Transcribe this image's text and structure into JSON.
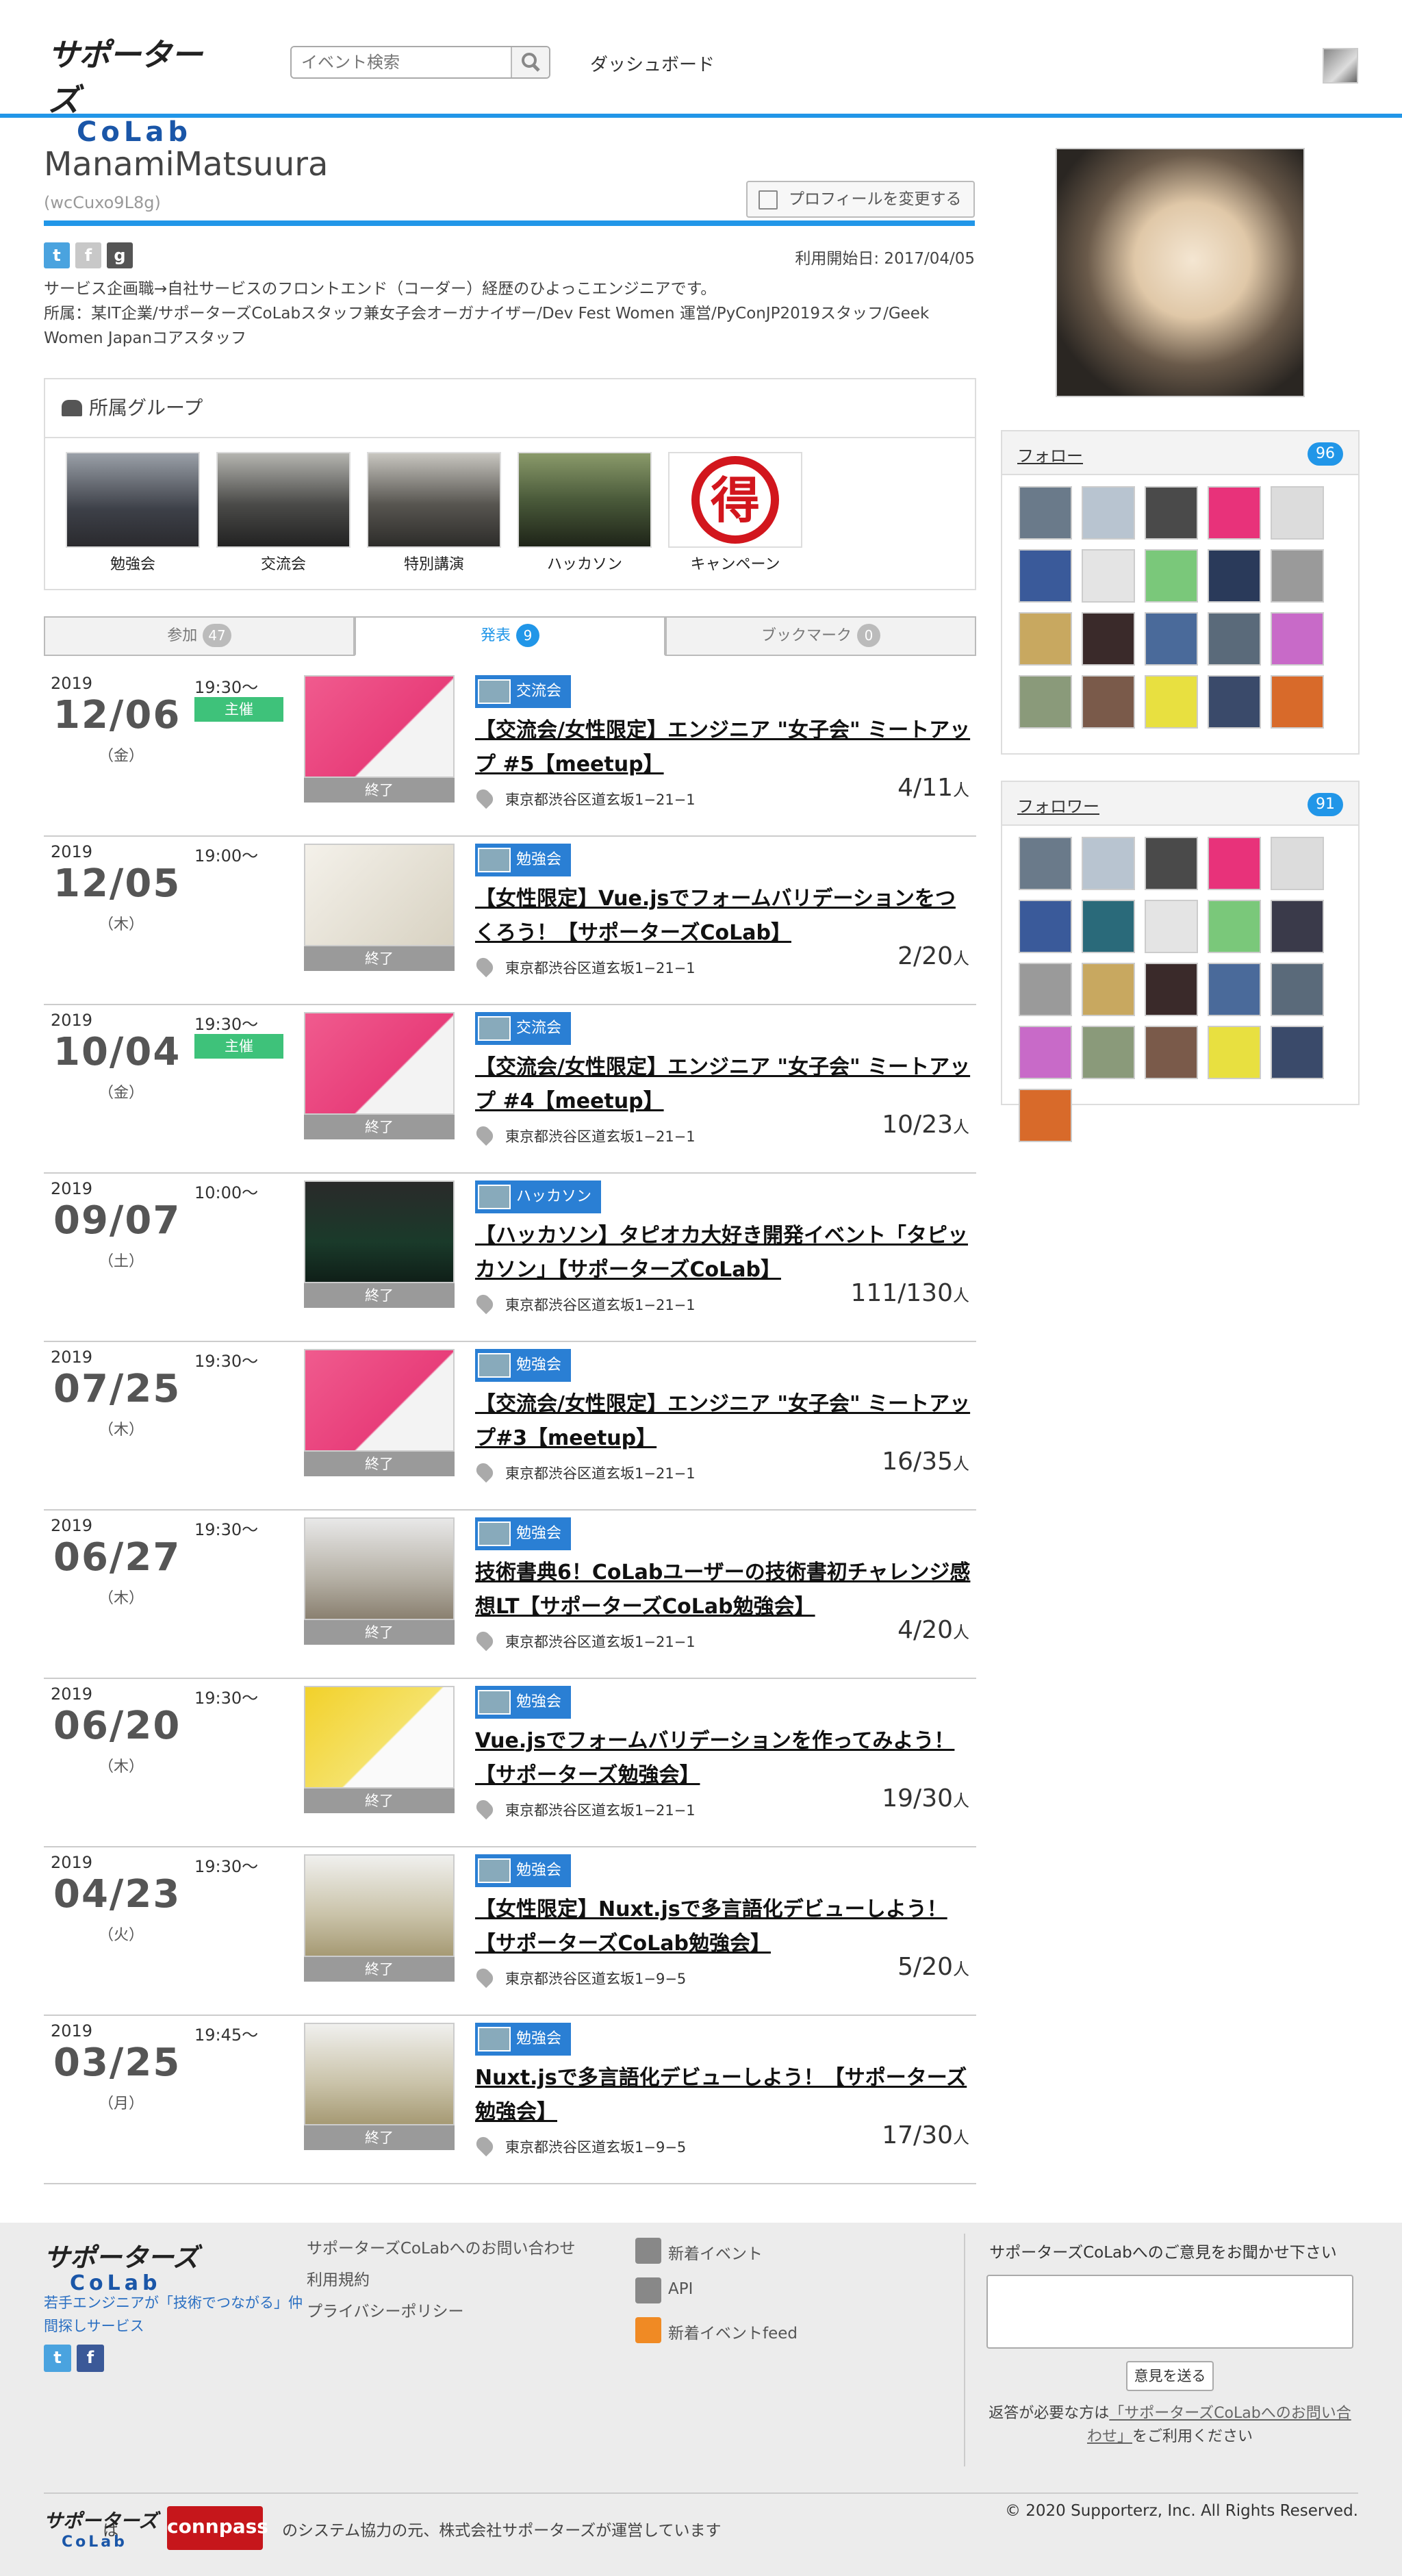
{
  "header": {
    "logo_line1": "サポーターズ",
    "logo_line2": "CoLab",
    "search_placeholder": "イベント検索",
    "dashboard": "ダッシュボード"
  },
  "profile": {
    "name": "ManamiMatsuura",
    "id": "(wcCuxo9L8g)",
    "edit_button": "プロフィールを変更する",
    "since": "利用開始日: 2017/04/05",
    "bio_line1": "サービス企画職→自社サービスのフロントエンド（コーダー）経歴のひよっこエンジニアです。",
    "bio_line2": "所属：某IT企業/サポーターズCoLabスタッフ兼女子会オーガナイザー/Dev Fest Women 運営/PyConJP2019スタッフ/Geek Women Japanコアスタッフ",
    "social": [
      "twitter-icon",
      "facebook-icon",
      "github-icon"
    ]
  },
  "groups": {
    "title": "所属グループ",
    "items": [
      {
        "label": "勉強会"
      },
      {
        "label": "交流会"
      },
      {
        "label": "特別講演"
      },
      {
        "label": "ハッカソン"
      },
      {
        "label": "キャンペーン"
      }
    ]
  },
  "tabs": [
    {
      "label": "参加",
      "count": "47"
    },
    {
      "label": "発表",
      "count": "9"
    },
    {
      "label": "ブックマーク",
      "count": "0"
    }
  ],
  "events": [
    {
      "year": "2019",
      "date": "12/06",
      "dow": "（金）",
      "time": "19:30〜",
      "host": "主催",
      "status": "終了",
      "tag": "交流会",
      "title": "【交流会/女性限定】エンジニア \"女子会\" ミートアップ #5【meetup】",
      "location": "東京都渋谷区道玄坂1−21−1",
      "count": "4/11",
      "unit": "人"
    },
    {
      "year": "2019",
      "date": "12/05",
      "dow": "（木）",
      "time": "19:00〜",
      "host": "",
      "status": "終了",
      "tag": "勉強会",
      "title": "【女性限定】Vue.jsでフォームバリデーションをつくろう！【サポーターズCoLab】",
      "location": "東京都渋谷区道玄坂1−21−1",
      "count": "2/20",
      "unit": "人"
    },
    {
      "year": "2019",
      "date": "10/04",
      "dow": "（金）",
      "time": "19:30〜",
      "host": "主催",
      "status": "終了",
      "tag": "交流会",
      "title": "【交流会/女性限定】エンジニア \"女子会\" ミートアップ #4【meetup】",
      "location": "東京都渋谷区道玄坂1−21−1",
      "count": "10/23",
      "unit": "人"
    },
    {
      "year": "2019",
      "date": "09/07",
      "dow": "（土）",
      "time": "10:00〜",
      "host": "",
      "status": "終了",
      "tag": "ハッカソン",
      "title": "【ハッカソン】タピオカ大好き開発イベント「タピッカソン」【サポーターズCoLab】",
      "location": "東京都渋谷区道玄坂1−21−1",
      "count": "111/130",
      "unit": "人"
    },
    {
      "year": "2019",
      "date": "07/25",
      "dow": "（木）",
      "time": "19:30〜",
      "host": "",
      "status": "終了",
      "tag": "勉強会",
      "title": "【交流会/女性限定】エンジニア \"女子会\" ミートアップ#3【meetup】",
      "location": "東京都渋谷区道玄坂1−21−1",
      "count": "16/35",
      "unit": "人"
    },
    {
      "year": "2019",
      "date": "06/27",
      "dow": "（木）",
      "time": "19:30〜",
      "host": "",
      "status": "終了",
      "tag": "勉強会",
      "title": "技術書典6！CoLabユーザーの技術書初チャレンジ感想LT【サポーターズCoLab勉強会】",
      "location": "東京都渋谷区道玄坂1−21−1",
      "count": "4/20",
      "unit": "人"
    },
    {
      "year": "2019",
      "date": "06/20",
      "dow": "（木）",
      "time": "19:30〜",
      "host": "",
      "status": "終了",
      "tag": "勉強会",
      "title": "Vue.jsでフォームバリデーションを作ってみよう！【サポーターズ勉強会】",
      "location": "東京都渋谷区道玄坂1−21−1",
      "count": "19/30",
      "unit": "人"
    },
    {
      "year": "2019",
      "date": "04/23",
      "dow": "（火）",
      "time": "19:30〜",
      "host": "",
      "status": "終了",
      "tag": "勉強会",
      "title": "【女性限定】Nuxt.jsで多言語化デビューしよう！【サポーターズCoLab勉強会】",
      "location": "東京都渋谷区道玄坂1−9−5",
      "count": "5/20",
      "unit": "人"
    },
    {
      "year": "2019",
      "date": "03/25",
      "dow": "（月）",
      "time": "19:45〜",
      "host": "",
      "status": "終了",
      "tag": "勉強会",
      "title": "Nuxt.jsで多言語化デビューしよう！【サポーターズ勉強会】",
      "location": "東京都渋谷区道玄坂1−9−5",
      "count": "17/30",
      "unit": "人"
    }
  ],
  "follow": {
    "title": "フォロー",
    "count": "96"
  },
  "follower": {
    "title": "フォロワー",
    "count": "91"
  },
  "footer": {
    "logo_line1": "サポーターズ",
    "logo_line2": "CoLab",
    "tagline": "若手エンジニアが「技術でつながる」仲間探しサービス",
    "links": [
      "サポーターズCoLabへのお問い合わせ",
      "利用規約",
      "プライバシーポリシー"
    ],
    "links2": [
      "新着イベント",
      "API",
      "新着イベントfeed"
    ],
    "opinion_title": "サポーターズCoLabへのご意見をお聞かせ下さい",
    "send": "意見を送る",
    "note_pre": "返答が必要な方は",
    "note_link": "「サポーターズCoLabへのお問い合わせ」",
    "note_post": "をご利用ください",
    "is": "は",
    "connpass": "connpass",
    "system_note": "のシステム協力の元、株式会社サポーターズが運営しています",
    "copyright": "© 2020 Supporterz, Inc. All Rights Reserved."
  }
}
